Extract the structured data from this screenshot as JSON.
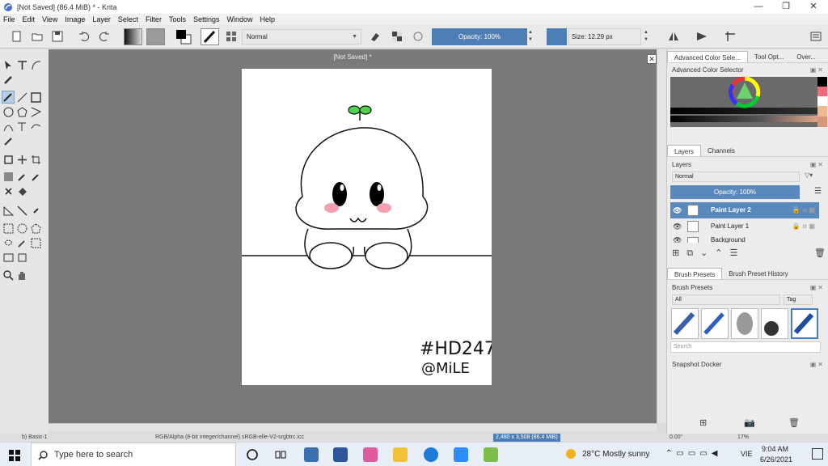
{
  "window": {
    "title": "[Not Saved]  (86.4 MiB)  * - Krita",
    "minimize_icon": "minimize-icon",
    "maximize_icon": "restore-icon",
    "close_icon": "close-icon"
  },
  "menu": [
    "File",
    "Edit",
    "View",
    "Image",
    "Layer",
    "Select",
    "Filter",
    "Tools",
    "Settings",
    "Window",
    "Help"
  ],
  "toolbar": {
    "blend_mode": "Normal",
    "opacity_label": "Opacity: 100%",
    "size_label": "Size: 12.29 px"
  },
  "document": {
    "tab_title": "[Not Saved]  *",
    "close_label": "✕",
    "drawing_text_line1": "#HD247",
    "drawing_text_line2": "@MiLE"
  },
  "dockers": {
    "top_tabs": [
      "Advanced Color Sele...",
      "Tool Opt...",
      "Over..."
    ],
    "color_selector_title": "Advanced Color Selector",
    "layer_tabs": [
      "Layers",
      "Channels"
    ],
    "layers_title": "Layers",
    "layer_blend": "Normal",
    "layer_opacity": "Opacity:  100%",
    "layers": [
      {
        "name": "Paint Layer 2",
        "selected": true
      },
      {
        "name": "Paint Layer 1",
        "selected": false
      },
      {
        "name": "Background",
        "selected": false
      }
    ],
    "brush_tabs": [
      "Brush Presets",
      "Brush Preset History"
    ],
    "brush_presets_title": "Brush Presets",
    "presets_filter": "All",
    "tag_label": "Tag",
    "search_placeholder": "Search",
    "snapshot_title": "Snapshot Docker"
  },
  "statusbar": {
    "brush": "b) Basic-1",
    "color_model": "RGB/Alpha (8-bit integer/channel)  sRGB-elle-V2-srgbtrc.icc",
    "dimensions": "2,480 x 3,508 (86.4 MiB)",
    "rotation": "0.00°",
    "zoom": "17%"
  },
  "taskbar": {
    "search_placeholder": "Type here to search",
    "weather": "28°C  Mostly sunny",
    "language": "VIE",
    "time": "9:04 AM",
    "date": "6/26/2021"
  },
  "colors": {
    "accent": "#4d7eb5",
    "canvas_bg": "#7a7a7a",
    "selected_layer": "#5989bd",
    "sprout": "#4fd44f",
    "blush": "#f5a0b0"
  }
}
